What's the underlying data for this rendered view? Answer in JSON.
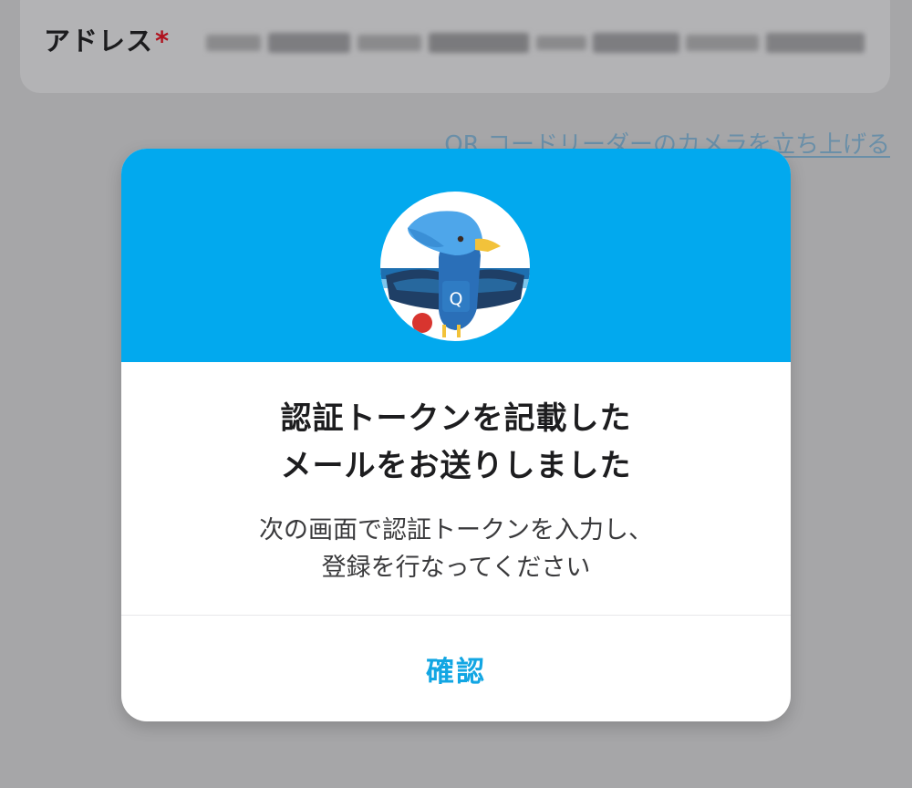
{
  "form": {
    "address_label": "アドレス",
    "required_mark": "*"
  },
  "qr_link": {
    "label": "QR コードリーダーのカメラを立ち上げる"
  },
  "dialog": {
    "title_line1": "認証トークンを記載した",
    "title_line2": "メールをお送りしました",
    "message_line1": "次の画面で認証トークンを入力し、",
    "message_line2": "登録を行なってください",
    "confirm_label": "確認",
    "logo_letter": "Q"
  },
  "colors": {
    "header_blue": "#02a9ee",
    "link_blue": "#12a6e3",
    "required_red": "#b0121e",
    "overlay_gray": "#a6a6a8"
  }
}
